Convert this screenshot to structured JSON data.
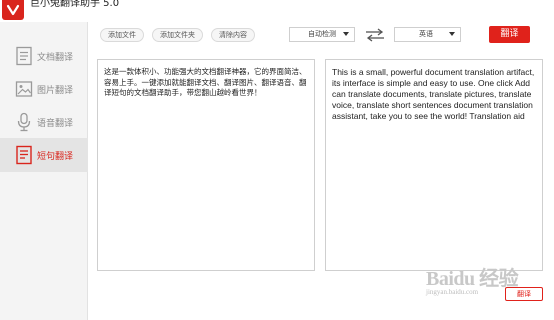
{
  "app": {
    "title": "巨小兔翻译助手 5.0"
  },
  "sidebar": {
    "items": [
      {
        "label": "文档翻译",
        "icon": "document-icon"
      },
      {
        "label": "图片翻译",
        "icon": "image-icon"
      },
      {
        "label": "语音翻译",
        "icon": "microphone-icon"
      },
      {
        "label": "短句翻译",
        "icon": "note-icon"
      }
    ],
    "active_index": 3
  },
  "toolbar": {
    "add_file": "添加文件",
    "add_folder": "添加文件夹",
    "clear": "清除内容"
  },
  "language": {
    "source": "自动检测",
    "target": "英语"
  },
  "actions": {
    "translate": "翻译",
    "translate_small": "翻译"
  },
  "source_text": "这是一款体积小、功能强大的文档翻译神器，它的界面简洁、容易上手。一键添加就能翻译文档、翻译图片、翻译语音、翻译短句的文档翻译助手，带您翻山越岭看世界！",
  "target_text": "This is a small, powerful document translation artifact, its interface is simple and easy to use. One click Add can translate documents, translate pictures, translate voice, translate short sentences document translation assistant, take you to see the world! Translation aid",
  "watermark": {
    "main": "Baidu 经验",
    "sub": "jingyan.baidu.com"
  },
  "colors": {
    "accent": "#e0221b",
    "sidebar_bg": "#f4f4f4",
    "active_bg": "#e4e4e4"
  }
}
